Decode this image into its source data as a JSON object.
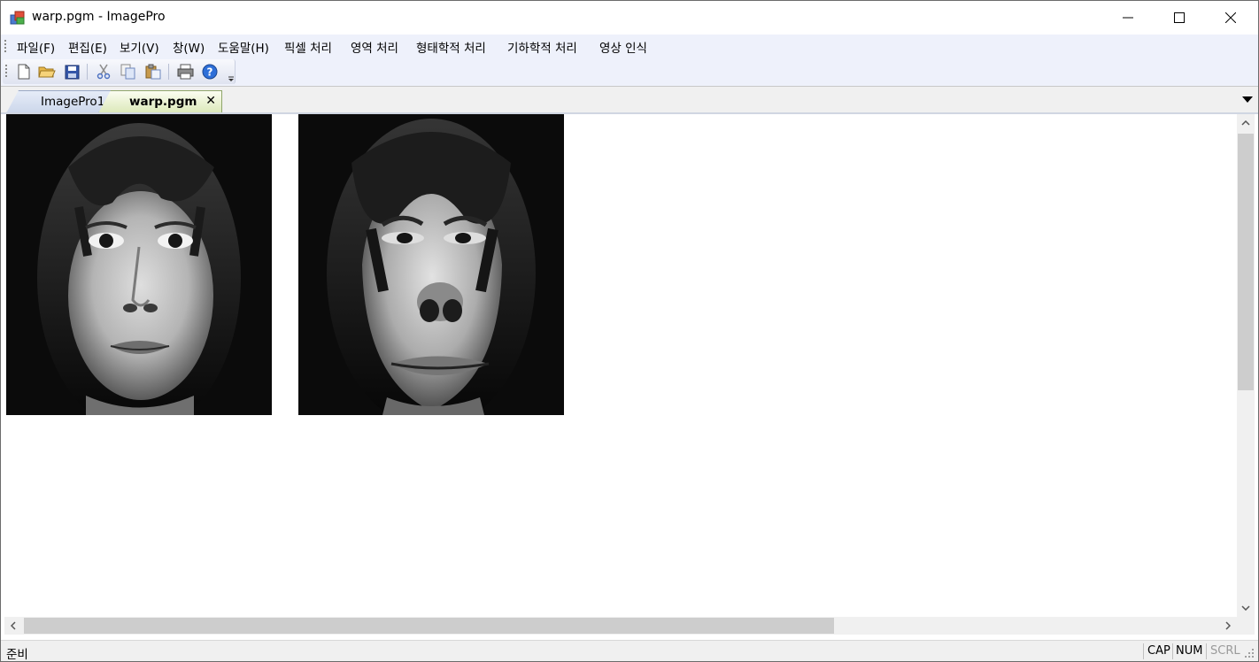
{
  "window": {
    "title": "warp.pgm - ImagePro"
  },
  "menu": {
    "items": [
      {
        "label": "파일(F)"
      },
      {
        "label": "편집(E)"
      },
      {
        "label": "보기(V)"
      },
      {
        "label": "창(W)"
      },
      {
        "label": "도움말(H)"
      },
      {
        "label": "픽셀 처리"
      },
      {
        "label": "영역 처리"
      },
      {
        "label": "형태학적 처리"
      },
      {
        "label": "기하학적 처리"
      },
      {
        "label": "영상 인식"
      }
    ]
  },
  "toolbar": {
    "buttons": [
      "new-file-icon",
      "open-folder-icon",
      "save-disk-icon",
      "cut-scissors-icon",
      "copy-icon",
      "paste-icon",
      "print-icon",
      "help-icon"
    ]
  },
  "tabs": [
    {
      "label": "ImagePro1",
      "active": false
    },
    {
      "label": "warp.pgm",
      "active": true,
      "close": "✕"
    }
  ],
  "images": [
    {
      "name": "original-face"
    },
    {
      "name": "warped-face"
    }
  ],
  "status": {
    "text": "준비",
    "indicators": [
      {
        "label": "CAP",
        "enabled": true
      },
      {
        "label": "NUM",
        "enabled": true
      },
      {
        "label": "SCRL",
        "enabled": false
      }
    ]
  },
  "colors": {
    "menu_background": "#eef1fb",
    "active_tab": "#dbe8b8",
    "inactive_tab": "#cbd6ea",
    "scroll_thumb": "#cdcdcd"
  }
}
